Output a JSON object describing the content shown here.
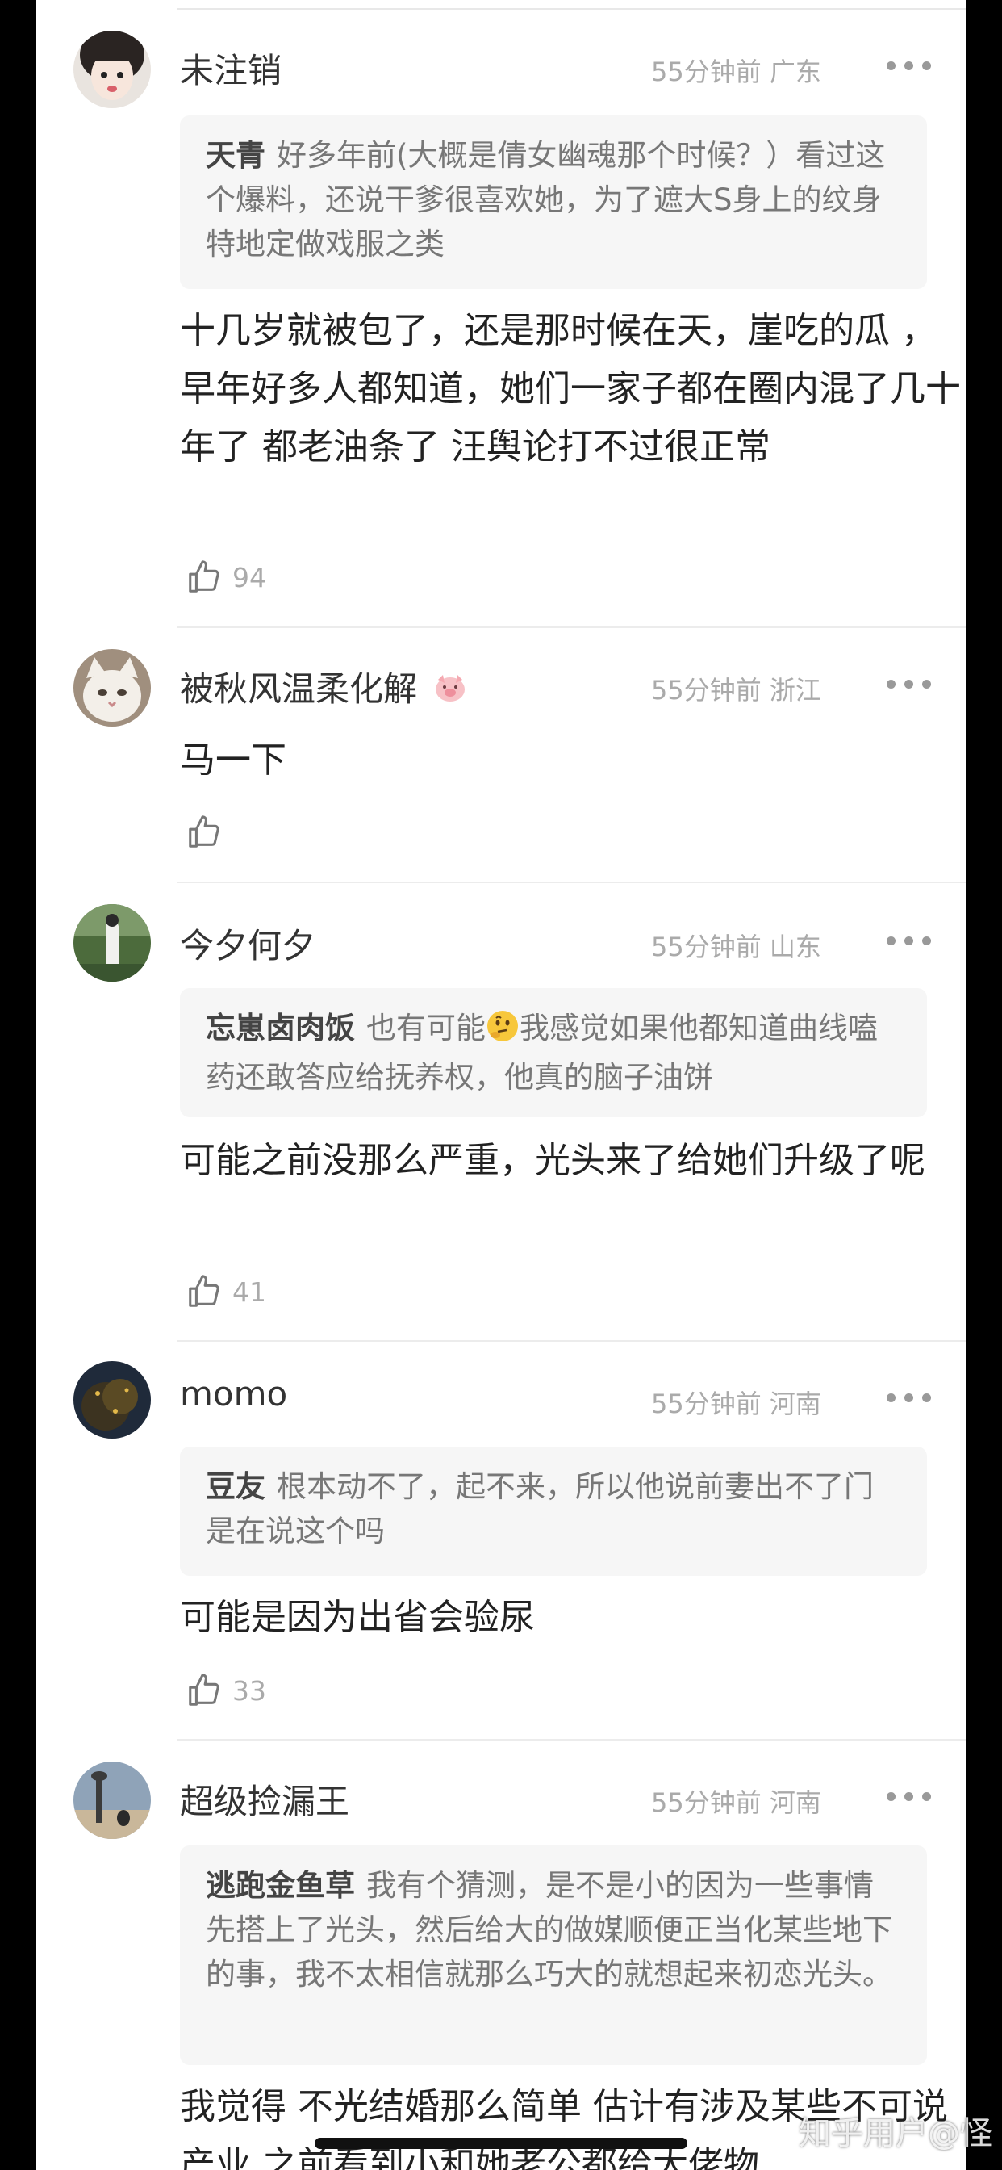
{
  "comments": [
    {
      "name": "未注销",
      "meta": "55分钟前 广东",
      "quote_author": "天青",
      "quote_text": "好多年前(大概是倩女幽魂那个时候？）看过这个爆料，还说干爹很喜欢她，为了遮大S身上的纹身特地定做戏服之类",
      "text": "十几岁就被包了，还是那时候在天，崖吃的瓜 ，早年好多人都知道，她们一家子都在圈内混了几十年了 都老油条了 汪舆论打不过很正常",
      "likes": "94"
    },
    {
      "name": "被秋风温柔化解",
      "meta": "55分钟前 浙江",
      "text": "马一下",
      "likes": ""
    },
    {
      "name": "今夕何夕",
      "meta": "55分钟前 山东",
      "quote_author": "忘崽卤肉饭",
      "quote_text_before": "也有可能",
      "quote_text_after": "我感觉如果他都知道曲线嗑药还敢答应给抚养权，他真的脑子油饼",
      "text": "可能之前没那么严重，光头来了给她们升级了呢",
      "likes": "41"
    },
    {
      "name": "momo",
      "meta": "55分钟前 河南",
      "quote_author": "豆友",
      "quote_text": "根本动不了，起不来，所以他说前妻出不了门是在说这个吗",
      "text": "可能是因为出省会验尿",
      "likes": "33"
    },
    {
      "name": "超级捡漏王",
      "meta": "55分钟前 河南",
      "quote_author": "逃跑金鱼草",
      "quote_text": "我有个猜测，是不是小的因为一些事情先搭上了光头，然后给大的做媒顺便正当化某些地下的事，我不太相信就那么巧大的就想起来初恋光头。",
      "text": "我觉得 不光结婚那么简单 估计有涉及某些不可说产业 之前看到小和她老公都给大佬物"
    }
  ],
  "watermark": "知乎用户@怪",
  "icons": {
    "like": "thumbs-up-icon",
    "more": "more-dots-icon",
    "pig": "pig-badge-icon",
    "think": "thinking-face-emoji-icon"
  },
  "colors": {
    "name": "#333333",
    "meta": "#aaaaaa",
    "quote_bg": "#f6f6f6",
    "text": "#222222"
  }
}
